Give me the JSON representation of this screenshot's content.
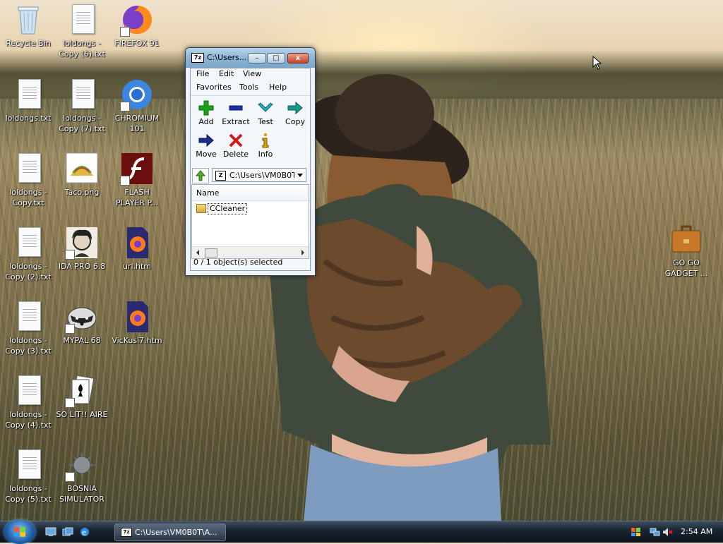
{
  "desktop": {
    "icons": [
      {
        "label": "Recycle Bin"
      },
      {
        "label": "loldongs -\nCopy (6).txt"
      },
      {
        "label": "FIREFOX 91"
      },
      {
        "label": "loldongs.txt"
      },
      {
        "label": "loldongs -\nCopy (7).txt"
      },
      {
        "label": "CHROMIUM\n101"
      },
      {
        "label": "loldongs -\nCopy.txt"
      },
      {
        "label": "Taco.png"
      },
      {
        "label": "FLASH\nPLAYER P..."
      },
      {
        "label": "loldongs -\nCopy (2).txt"
      },
      {
        "label": "IDA PRO 6.8"
      },
      {
        "label": "url.htm"
      },
      {
        "label": "loldongs -\nCopy (3).txt"
      },
      {
        "label": "MYPAL 68"
      },
      {
        "label": "VicKusi7.htm"
      },
      {
        "label": "loldongs -\nCopy (4).txt"
      },
      {
        "label": "SO LIT!! AIRE"
      },
      {
        "label": "loldongs -\nCopy (5).txt"
      },
      {
        "label": "BOSNIA\nSIMULATOR"
      },
      {
        "label": "GO GO\nGADGET ..."
      }
    ]
  },
  "window": {
    "title": "C:\\Users...",
    "app_icon_text": "7z",
    "minimize": "–",
    "maximize": "□",
    "close": "x",
    "menu": [
      "File",
      "Edit",
      "View",
      "Favorites",
      "Tools",
      "Help"
    ],
    "toolbar": [
      {
        "label": "Add",
        "icon": "plus-icon",
        "color": "#1aa31a"
      },
      {
        "label": "Extract",
        "icon": "minus-icon",
        "color": "#1a2ea8"
      },
      {
        "label": "Test",
        "icon": "check-icon",
        "color": "#2aa9c0"
      },
      {
        "label": "Copy",
        "icon": "arrow-right-icon",
        "color": "#1a9a8a"
      },
      {
        "label": "Move",
        "icon": "arrow-right-icon",
        "color": "#1a2e8a"
      },
      {
        "label": "Delete",
        "icon": "x-icon",
        "color": "#d01818"
      },
      {
        "label": "Info",
        "icon": "info-icon",
        "color": "#d8a400"
      }
    ],
    "address": "C:\\Users\\VM0B0T",
    "column_name": "Name",
    "items": [
      {
        "name": "CCleaner"
      }
    ],
    "status": "0 / 1 object(s) selected"
  },
  "taskbar": {
    "active_task": "C:\\Users\\VM0B0T\\A...",
    "clock": "2:54 AM"
  }
}
